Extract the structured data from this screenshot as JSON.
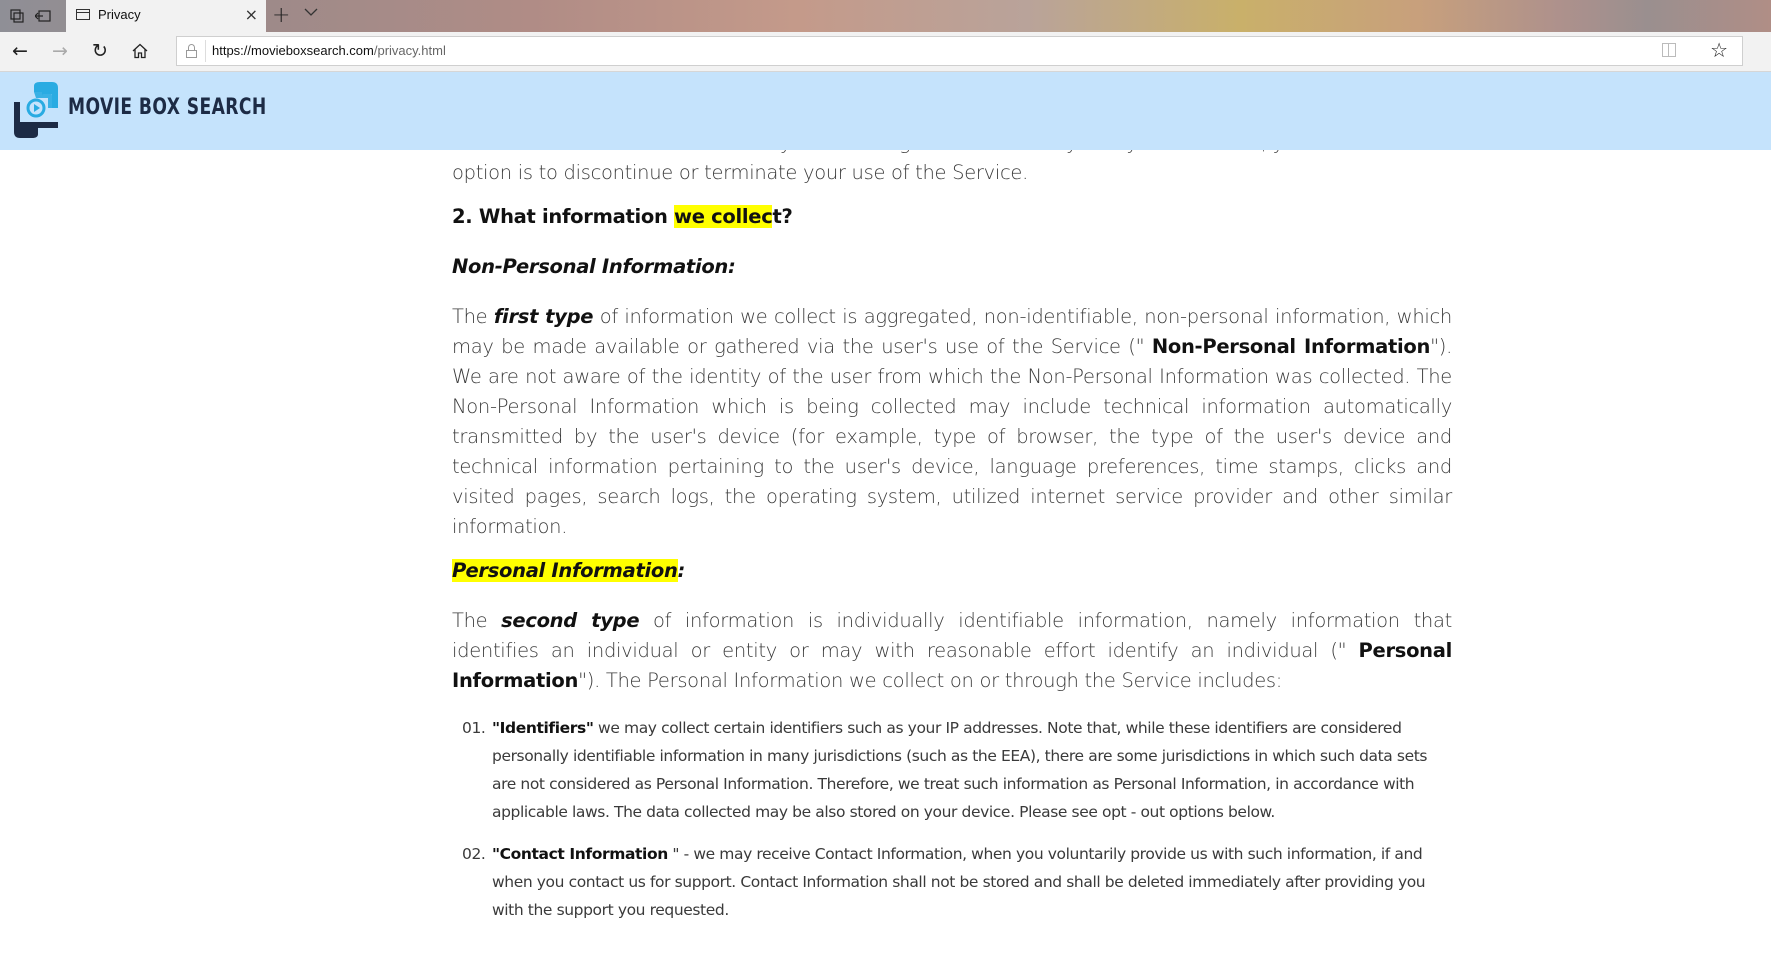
{
  "browser": {
    "tab_title": "Privacy",
    "url_host": "https://movieboxsearch.com",
    "url_path": "/privacy.html",
    "icons": {
      "set_aside": "tabs-aside-icon",
      "restore": "restore-tabs-icon",
      "tab_page": "page-icon",
      "close": "×",
      "new_tab": "+",
      "tab_list": "⌄",
      "back": "←",
      "forward": "→",
      "refresh": "↻",
      "home": "⌂",
      "star": "☆"
    }
  },
  "header": {
    "logo_text": "MOVIE BOX SEARCH",
    "background": "#c5e3fc",
    "logo_colors": {
      "blue": "#29abe2",
      "dark": "#1d2b45"
    }
  },
  "content": {
    "intro_tail_line1": "amendments from time to time. If you do not agree to the Privacy Policy as amended, your sole and exclusive",
    "intro_tail_line2": "option is to discontinue or terminate your use of the Service.",
    "section_heading_prefix": "2. What information ",
    "section_heading_highlight": "we collec",
    "section_heading_suffix": "t?",
    "non_personal": {
      "heading": "Non-Personal Information:",
      "p_start": "The ",
      "p_em": "first type",
      "p_mid": " of information we collect is aggregated, non-identifiable, non-personal information, which may be made available or gathered via the user's use of the Service (\" ",
      "p_bold": "Non-Personal Information",
      "p_end": "\"). We are not aware of the identity of the user from which the Non-Personal Information was collected. The Non-Personal Information which is being collected may include technical information automatically transmitted by the user's device (for example, type of browser, the type of the user's device and technical information pertaining to the user's device, language preferences, time stamps, clicks and visited pages, search logs, the operating system, utilized internet service provider and other similar information."
    },
    "personal": {
      "heading_highlight": "Personal Information",
      "heading_suffix": ":",
      "p_start": "The ",
      "p_em": "second type",
      "p_mid": " of information is individually identifiable information, namely information that identifies an individual or entity or may with reasonable effort identify an individual (\" ",
      "p_bold": "Personal Information",
      "p_end": "\"). The Personal Information we collect on or through the Service includes:"
    },
    "list": [
      {
        "num": "01.",
        "bold": "\"Identifiers\"",
        "text": " we may collect certain identifiers such as your IP addresses. Note that, while these identifiers are considered personally identifiable information in many jurisdictions (such as the EEA), there are some jurisdictions in which such data sets are not considered as Personal Information. Therefore, we treat such information as Personal Information, in accordance with applicable laws. The data collected may be also stored on your device. Please see opt - out options below."
      },
      {
        "num": "02.",
        "bold": "\"Contact Information",
        "text": " \" - we may receive Contact Information, when you voluntarily provide us with such information, if and when you contact us for support. Contact Information shall not be stored and shall be deleted immediately after providing you with the support you requested."
      }
    ],
    "highlight_color": "#ffff00"
  }
}
